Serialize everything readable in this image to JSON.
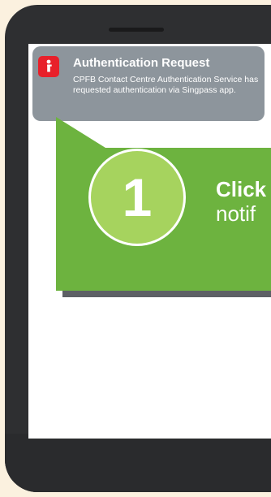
{
  "notification": {
    "title": "Authentication Request",
    "body": "CPFB Contact Centre Authentication Service has requested authentication via Singpass app.",
    "icon": "singpass-app-icon"
  },
  "callout": {
    "step_number": "1",
    "text_bold": "Click",
    "text_normal": "notif"
  },
  "colors": {
    "background": "#fbf1df",
    "phone": "#2e2f31",
    "notification": "#8d959c",
    "app_icon": "#e8202a",
    "callout_green": "#6db33f",
    "step_circle": "#a6d35e"
  }
}
